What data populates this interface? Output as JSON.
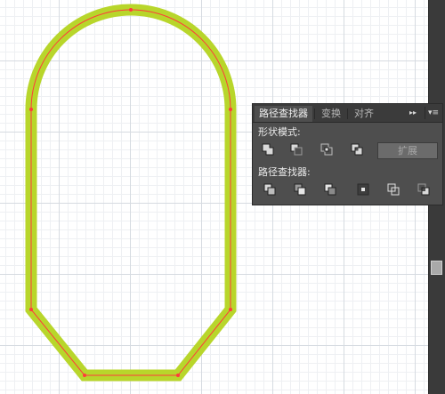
{
  "artwork": {
    "stroke_color": "#b8d62b",
    "path_color": "#ff3b3b",
    "anchor_color": "#ff3b3b"
  },
  "panel": {
    "tabs": [
      {
        "label": "路径查找器",
        "active": true
      },
      {
        "label": "变换",
        "active": false
      },
      {
        "label": "对齐",
        "active": false
      }
    ],
    "collapse_glyph": "▸▸",
    "menu_glyph": "▾≡",
    "shape_modes_label": "形状模式:",
    "pathfinders_label": "路径查找器:",
    "expand_label": "扩展",
    "shape_mode_icons": [
      "unite-icon",
      "minus-front-icon",
      "intersect-icon",
      "exclude-icon"
    ],
    "pathfinder_icons": [
      "divide-icon",
      "trim-icon",
      "merge-icon",
      "crop-icon",
      "outline-icon",
      "minus-back-icon"
    ]
  }
}
